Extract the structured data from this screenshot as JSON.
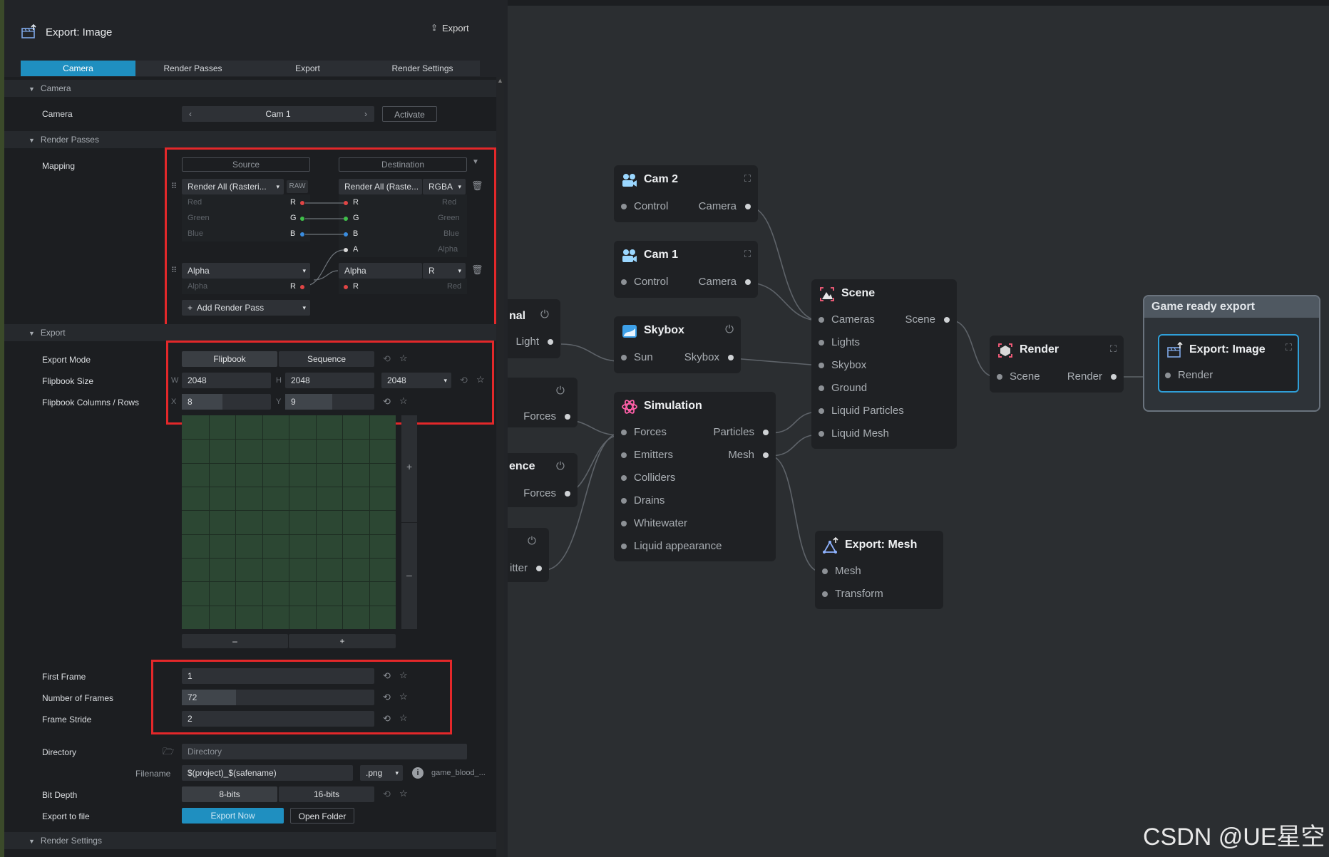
{
  "panel": {
    "title": "Export: Image",
    "export_button": "Export",
    "tabs": [
      "Camera",
      "Render Passes",
      "Export",
      "Render Settings"
    ],
    "active_tab": "Camera"
  },
  "camera_section": {
    "header": "Camera",
    "camera_label": "Camera",
    "camera_value": "Cam 1",
    "activate_button": "Activate"
  },
  "render_passes_section": {
    "header": "Render Passes",
    "mapping_label": "Mapping",
    "source_header": "Source",
    "destination_header": "Destination",
    "pass1": {
      "source": "Render All (Rasteri...",
      "source_badge": "RAW",
      "dest": "Render All (Raste...",
      "dest_format": "RGBA",
      "src_channels": [
        {
          "name": "Red",
          "ch": "R",
          "color": "#e04545"
        },
        {
          "name": "Green",
          "ch": "G",
          "color": "#3fbf4a"
        },
        {
          "name": "Blue",
          "ch": "B",
          "color": "#3a8de0"
        }
      ],
      "dst_channels": [
        {
          "ch": "R",
          "name": "Red",
          "color": "#e04545"
        },
        {
          "ch": "G",
          "name": "Green",
          "color": "#3fbf4a"
        },
        {
          "ch": "B",
          "name": "Blue",
          "color": "#3a8de0"
        },
        {
          "ch": "A",
          "name": "Alpha",
          "color": "#d8d8d8"
        }
      ]
    },
    "pass2": {
      "source": "Alpha",
      "dest": "Alpha",
      "dest_format": "R",
      "src_channel_name": "Alpha",
      "src_channel": "R",
      "dst_channel": "R",
      "dst_channel_name": "Red"
    },
    "add_button": "Add Render Pass"
  },
  "export_section": {
    "header": "Export",
    "export_mode_label": "Export Mode",
    "mode_options": [
      "Flipbook",
      "Sequence"
    ],
    "flipbook_size_label": "Flipbook Size",
    "w_prefix": "W",
    "h_prefix": "H",
    "w_value": "2048",
    "h_value": "2048",
    "size_preset": "2048",
    "cols_rows_label": "Flipbook Columns / Rows",
    "x_prefix": "X",
    "y_prefix": "Y",
    "cols": "8",
    "rows": "9",
    "grid_cols": 8,
    "grid_rows": 9,
    "minus": "–",
    "plus": "+",
    "first_frame_label": "First Frame",
    "first_frame": "1",
    "num_frames_label": "Number of Frames",
    "num_frames": "72",
    "frame_stride_label": "Frame Stride",
    "frame_stride": "2",
    "directory_label": "Directory",
    "directory_placeholder": "Directory",
    "filename_label": "Filename",
    "filename": "$(project)_$(safename)",
    "file_ext": ".png",
    "filename_preview": "game_blood_...",
    "bit_depth_label": "Bit Depth",
    "bit_options": [
      "8-bits",
      "16-bits"
    ],
    "export_to_file_label": "Export to file",
    "export_now": "Export Now",
    "open_folder": "Open Folder"
  },
  "render_settings_section": {
    "header": "Render Settings"
  },
  "graph": {
    "nodes": {
      "cam2": {
        "title": "Cam 2",
        "in": "Control",
        "out": "Camera"
      },
      "cam1": {
        "title": "Cam 1",
        "in": "Control",
        "out": "Camera"
      },
      "skybox": {
        "title": "Skybox",
        "in": "Sun",
        "out": "Skybox"
      },
      "simulation": {
        "title": "Simulation",
        "inputs": [
          "Forces",
          "Emitters",
          "Colliders",
          "Drains",
          "Whitewater",
          "Liquid appearance"
        ],
        "outputs": [
          "Particles",
          "Mesh"
        ]
      },
      "scene": {
        "title": "Scene",
        "inputs": [
          "Cameras",
          "Lights",
          "Skybox",
          "Ground",
          "Liquid Particles",
          "Liquid Mesh"
        ],
        "out": "Scene"
      },
      "render": {
        "title": "Render",
        "in": "Scene",
        "out": "Render"
      },
      "export_image": {
        "title": "Export: Image",
        "in": "Render"
      },
      "export_mesh": {
        "title": "Export: Mesh",
        "inputs": [
          "Mesh",
          "Transform"
        ]
      },
      "partial1": {
        "title": "nal",
        "out": "Light"
      },
      "partial2": {
        "out": "Forces"
      },
      "partial3": {
        "title": "ence",
        "out": "Forces"
      },
      "partial4": {
        "out": "itter"
      }
    },
    "group_title": "Game ready export"
  },
  "watermark": "CSDN @UE星空"
}
